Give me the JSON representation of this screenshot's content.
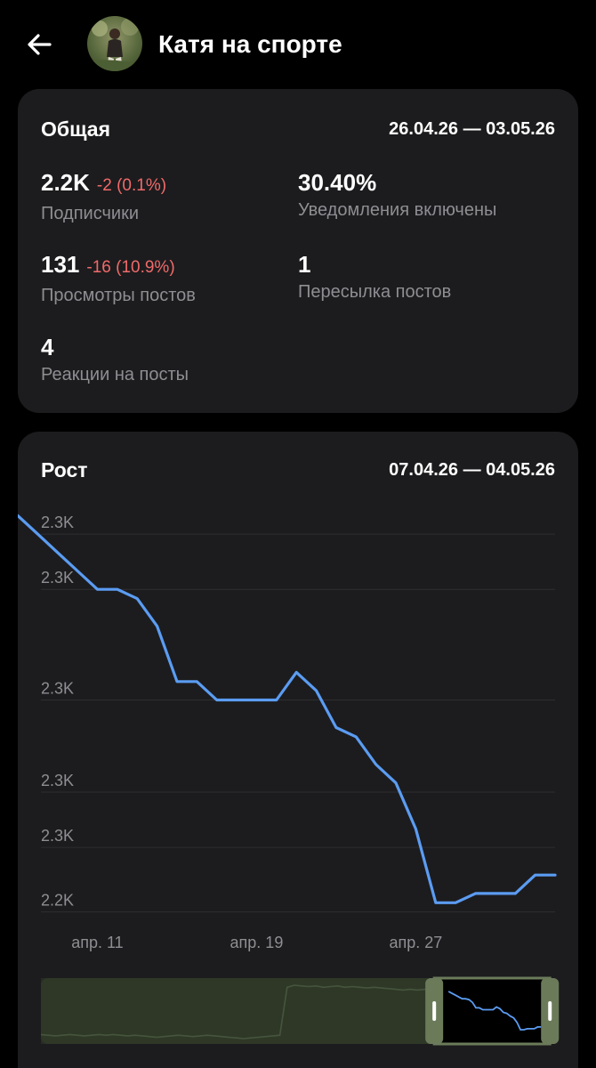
{
  "header": {
    "title": "Катя на спорте",
    "back_icon": "arrow-left-icon"
  },
  "overview": {
    "title": "Общая",
    "range": "26.04.26 — 03.05.26",
    "stats": [
      {
        "value": "2.2K",
        "delta": "-2 (0.1%)",
        "label": "Подписчики"
      },
      {
        "value": "30.40%",
        "delta": "",
        "label": "Уведомления включены"
      },
      {
        "value": "131",
        "delta": "-16 (10.9%)",
        "label": "Просмотры постов"
      },
      {
        "value": "1",
        "delta": "",
        "label": "Пересылка постов"
      },
      {
        "value": "4",
        "delta": "",
        "label": "Реакции на посты"
      }
    ],
    "delta_color": "#f06a6a"
  },
  "growth": {
    "title": "Рост",
    "range": "07.04.26 — 04.05.26"
  },
  "chart_data": {
    "type": "line",
    "x": [
      "апр. 7",
      "апр. 8",
      "апр. 9",
      "апр. 10",
      "апр. 11",
      "апр. 12",
      "апр. 13",
      "апр. 14",
      "апр. 15",
      "апр. 16",
      "апр. 17",
      "апр. 18",
      "апр. 19",
      "апр. 20",
      "апр. 21",
      "апр. 22",
      "апр. 23",
      "апр. 24",
      "апр. 25",
      "апр. 26",
      "апр. 27",
      "апр. 28",
      "апр. 29",
      "апр. 30",
      "май 1",
      "май 2",
      "май 3",
      "май 4"
    ],
    "values": [
      2298,
      2296,
      2294,
      2292,
      2290,
      2290,
      2289,
      2286,
      2280,
      2280,
      2278,
      2278,
      2278,
      2278,
      2281,
      2279,
      2275,
      2274,
      2271,
      2269,
      2264,
      2256,
      2256,
      2257,
      2257,
      2257,
      2259,
      2259
    ],
    "ylim": [
      2254,
      2299
    ],
    "yticks": [
      2255,
      2262,
      2268,
      2278,
      2290,
      2296
    ],
    "yticklabels": [
      "2.2K",
      "2.3K",
      "2.3K",
      "2.3K",
      "2.3K",
      "2.3K"
    ],
    "xticklabels": [
      "апр. 11",
      "апр. 19",
      "апр. 27"
    ],
    "xtick_index": [
      4,
      12,
      20
    ],
    "line_color": "#5b9cf2",
    "grid": true,
    "navigator": {
      "values": [
        2231,
        2230,
        2229,
        2230,
        2231,
        2230,
        2229,
        2230,
        2231,
        2230,
        2231,
        2230,
        2229,
        2230,
        2229,
        2228,
        2227,
        2228,
        2229,
        2230,
        2229,
        2228,
        2229,
        2230,
        2229,
        2228,
        2227,
        2226,
        2225,
        2226,
        2227,
        2228,
        2229,
        2230,
        2300,
        2303,
        2302,
        2301,
        2302,
        2300,
        2301,
        2302,
        2300,
        2301,
        2300,
        2299,
        2300,
        2299,
        2298,
        2297,
        2296,
        2297,
        2296,
        2297,
        2296,
        2295,
        2294,
        2293,
        2292,
        2293,
        2291,
        2290,
        2289,
        2290,
        2289,
        2291,
        2288,
        2287,
        2286,
        2285,
        2286,
        2285
      ],
      "selection_start": 0.765,
      "selection_end": 0.99
    }
  }
}
